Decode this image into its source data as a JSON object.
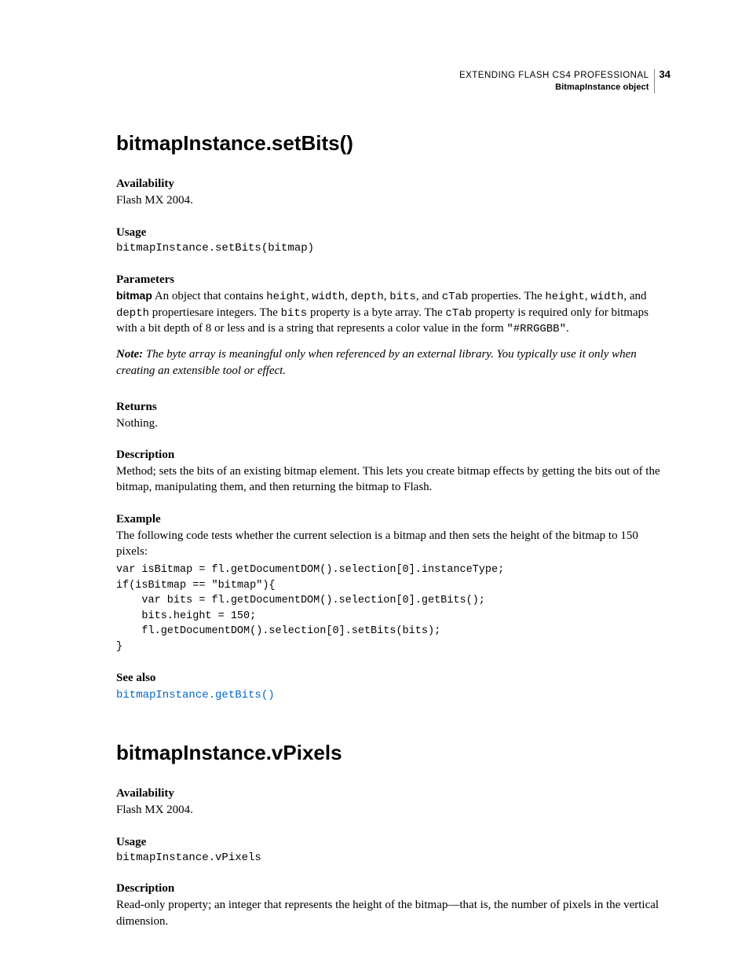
{
  "header": {
    "title": "EXTENDING FLASH CS4 PROFESSIONAL",
    "subtitle": "BitmapInstance object",
    "page_number": "34"
  },
  "section1": {
    "heading": "bitmapInstance.setBits()",
    "availability_label": "Availability",
    "availability_text": "Flash MX 2004.",
    "usage_label": "Usage",
    "usage_code": "bitmapInstance.setBits(bitmap)",
    "parameters_label": "Parameters",
    "param_name": "bitmap",
    "param_text_1a": " An object that contains ",
    "param_code_height": "height",
    "param_sep1": ", ",
    "param_code_width": "width",
    "param_sep2": ", ",
    "param_code_depth": "depth",
    "param_sep3": ", ",
    "param_code_bits": "bits",
    "param_sep4": ", and ",
    "param_code_ctab": "cTab",
    "param_text_1b": " properties. The ",
    "param_code_height2": "height",
    "param_sep5": ", ",
    "param_code_width2": "width",
    "param_sep6": ", and ",
    "param_code_depth2": "depth",
    "param_text_2a": " propertiesare integers. The ",
    "param_code_bits2": "bits",
    "param_text_2b": " property is a byte array. The ",
    "param_code_ctab2": "cTab",
    "param_text_2c": " property is required only for bitmaps with a bit depth of 8 or less and is a string that represents a color value in the form ",
    "param_code_rgb": "\"#RRGGBB\"",
    "param_text_2d": ".",
    "note_label": "Note: ",
    "note_text": "The byte array is meaningful only when referenced by an external library. You typically use it only when creating an extensible tool or effect.",
    "returns_label": "Returns",
    "returns_text": "Nothing.",
    "description_label": "Description",
    "description_text": "Method; sets the bits of an existing bitmap element. This lets you create bitmap effects by getting the bits out of the bitmap, manipulating them, and then returning the bitmap to Flash.",
    "example_label": "Example",
    "example_text": "The following code tests whether the current selection is a bitmap and then sets the height of the bitmap to 150 pixels:",
    "example_code": "var isBitmap = fl.getDocumentDOM().selection[0].instanceType;\nif(isBitmap == \"bitmap\"){\n    var bits = fl.getDocumentDOM().selection[0].getBits();\n    bits.height = 150;\n    fl.getDocumentDOM().selection[0].setBits(bits);\n}",
    "seealso_label": "See also",
    "seealso_link": "bitmapInstance.getBits()"
  },
  "section2": {
    "heading": "bitmapInstance.vPixels",
    "availability_label": "Availability",
    "availability_text": "Flash MX 2004.",
    "usage_label": "Usage",
    "usage_code": "bitmapInstance.vPixels",
    "description_label": "Description",
    "description_text": "Read-only property; an integer that represents the height of the bitmap—that is, the number of pixels in the vertical dimension."
  }
}
